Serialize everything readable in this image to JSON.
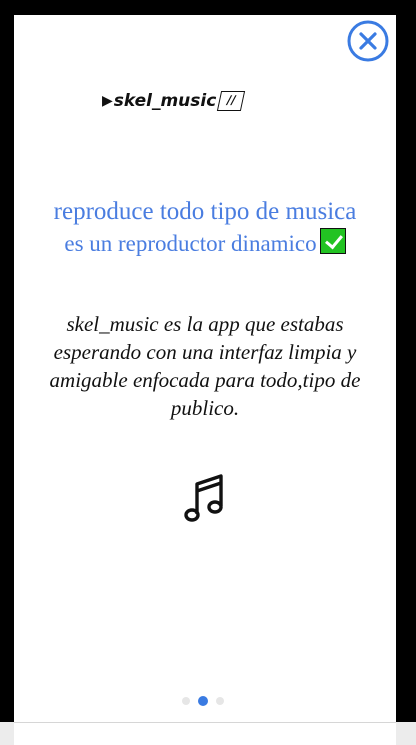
{
  "app": {
    "logo_text": "skel_music",
    "logo_play_glyph": "▶",
    "logo_pause_glyph": "//"
  },
  "headline": {
    "line1": "reproduce todo tipo de musica",
    "line2": "es un reproductor dinamico"
  },
  "description": "skel_music es la app que estabas esperando con una interfaz limpia y amigable enfocada para todo,tipo de publico.",
  "pager": {
    "count": 3,
    "active_index": 1
  },
  "colors": {
    "accent": "#4a7de0",
    "close": "#3a7be2",
    "check_bg": "#22c322",
    "dot_active": "#3a7be2",
    "dot_inactive": "#e6e6e6"
  },
  "icons": {
    "close": "close-circle-icon",
    "check": "check-box-icon",
    "music": "music-note-icon"
  }
}
